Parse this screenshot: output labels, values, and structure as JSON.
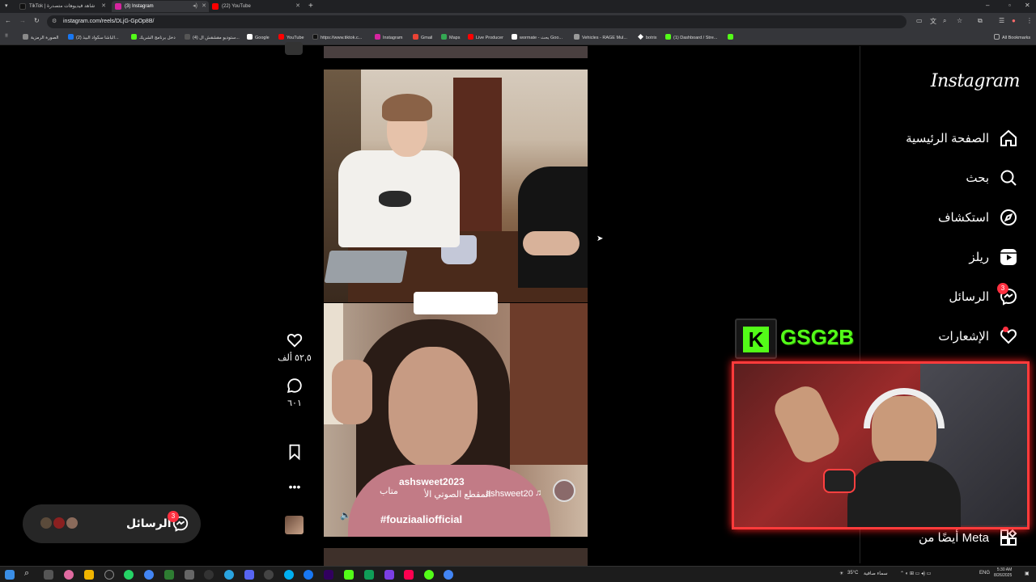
{
  "browser": {
    "tabs": [
      {
        "label": "TikTok | شاهد فيديوهات متصدرة",
        "color": "#111111"
      },
      {
        "label": "(3) Instagram",
        "color": "#d6249f"
      },
      {
        "label": "(22) YouTube",
        "color": "#ff0000"
      }
    ],
    "url": "instagram.com/reels/DLjG-GpOp8B/",
    "bookmarks": [
      {
        "label": "الصورة الرمزية",
        "color": "#8a8a8a"
      },
      {
        "label": "(2) الباشا سكواد البيذ...",
        "color": "#1877f2"
      },
      {
        "label": "دخل برنامج الشريك",
        "color": "#53fc18"
      },
      {
        "label": "(4) ستوديو مقشقش ال...",
        "color": "#555555"
      },
      {
        "label": "Google",
        "color": "#ffffff"
      },
      {
        "label": "YouTube",
        "color": "#ff0000"
      },
      {
        "label": "https://www.tiktok.c...",
        "color": "#111111"
      },
      {
        "label": "Instagram",
        "color": "#d6249f"
      },
      {
        "label": "Gmail",
        "color": "#ea4335"
      },
      {
        "label": "Maps",
        "color": "#34a853"
      },
      {
        "label": "Live Producer",
        "color": "#ff0000"
      },
      {
        "label": "wormate - بحث Goo...",
        "color": "#ffffff"
      },
      {
        "label": "Vehicles - RAGE Mul...",
        "color": "#999999"
      },
      {
        "label": "botrix",
        "color": "#ffffff"
      },
      {
        "label": "(1) Dashboard / Stre...",
        "color": "#53fc18"
      }
    ],
    "all_bookmarks": "All Bookmarks"
  },
  "instagram": {
    "logo": "Instagram",
    "nav": [
      {
        "label": "الصفحة الرئيسية",
        "icon": "home-icon"
      },
      {
        "label": "بحث",
        "icon": "search-icon"
      },
      {
        "label": "استكشاف",
        "icon": "explore-icon"
      },
      {
        "label": "ريلز",
        "icon": "reels-icon"
      },
      {
        "label": "الرسائل",
        "icon": "messenger-icon",
        "badge": "3"
      },
      {
        "label": "الإشعارات",
        "icon": "heart-icon"
      }
    ],
    "more_from_meta": "أيضًا من Meta"
  },
  "reel": {
    "emoji_caption": "😂😂😂😂",
    "author": "ashsweet2023",
    "follow": "متاب",
    "audio_original": "المقطع الصوتي الأ",
    "audio_author": "ashsweet20",
    "hashtag": "#fouziaaliofficial",
    "likes": "٥٢,٥ ألف",
    "comments": "٦٠١"
  },
  "messages_pill": {
    "label": "الرسائل",
    "badge": "3"
  },
  "stream_overlay": {
    "platform_logo": "K",
    "streamer_name": "GSG2B",
    "brand_color": "#53fc18",
    "frame_color": "#ff3b3b"
  },
  "taskbar": {
    "weather": "35°C",
    "weather_desc": "سماء صافية",
    "lang": "ENG",
    "time": "5:30 AM",
    "date": "8/26/2025"
  }
}
